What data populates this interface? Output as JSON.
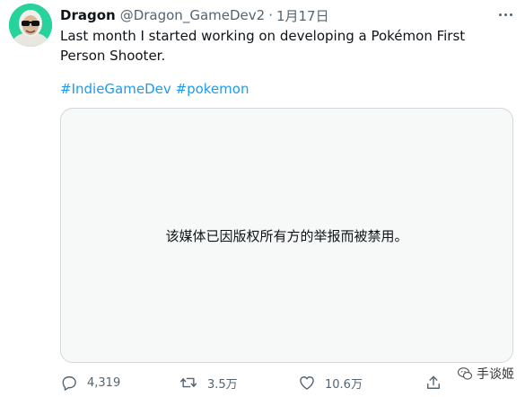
{
  "tweet": {
    "display_name": "Dragon",
    "handle": "@Dragon_GameDev2",
    "separator": "·",
    "timestamp": "1月17日",
    "text": "Last month I started working on developing a Pokémon First Person Shooter.",
    "hashtags": [
      "#IndieGameDev",
      "#pokemon"
    ],
    "media_notice": "该媒体已因版权所有方的举报而被禁用。"
  },
  "actions": {
    "replies": "4,319",
    "retweets": "3.5万",
    "likes": "10.6万"
  },
  "watermark": {
    "text": "手谈姬"
  },
  "icons": {
    "more": "more-icon",
    "reply": "reply-icon",
    "retweet": "retweet-icon",
    "like": "heart-icon",
    "share": "share-icon"
  },
  "colors": {
    "link": "#1d9bf0",
    "secondary_text": "#536471",
    "avatar_bg": "#27d39b"
  }
}
